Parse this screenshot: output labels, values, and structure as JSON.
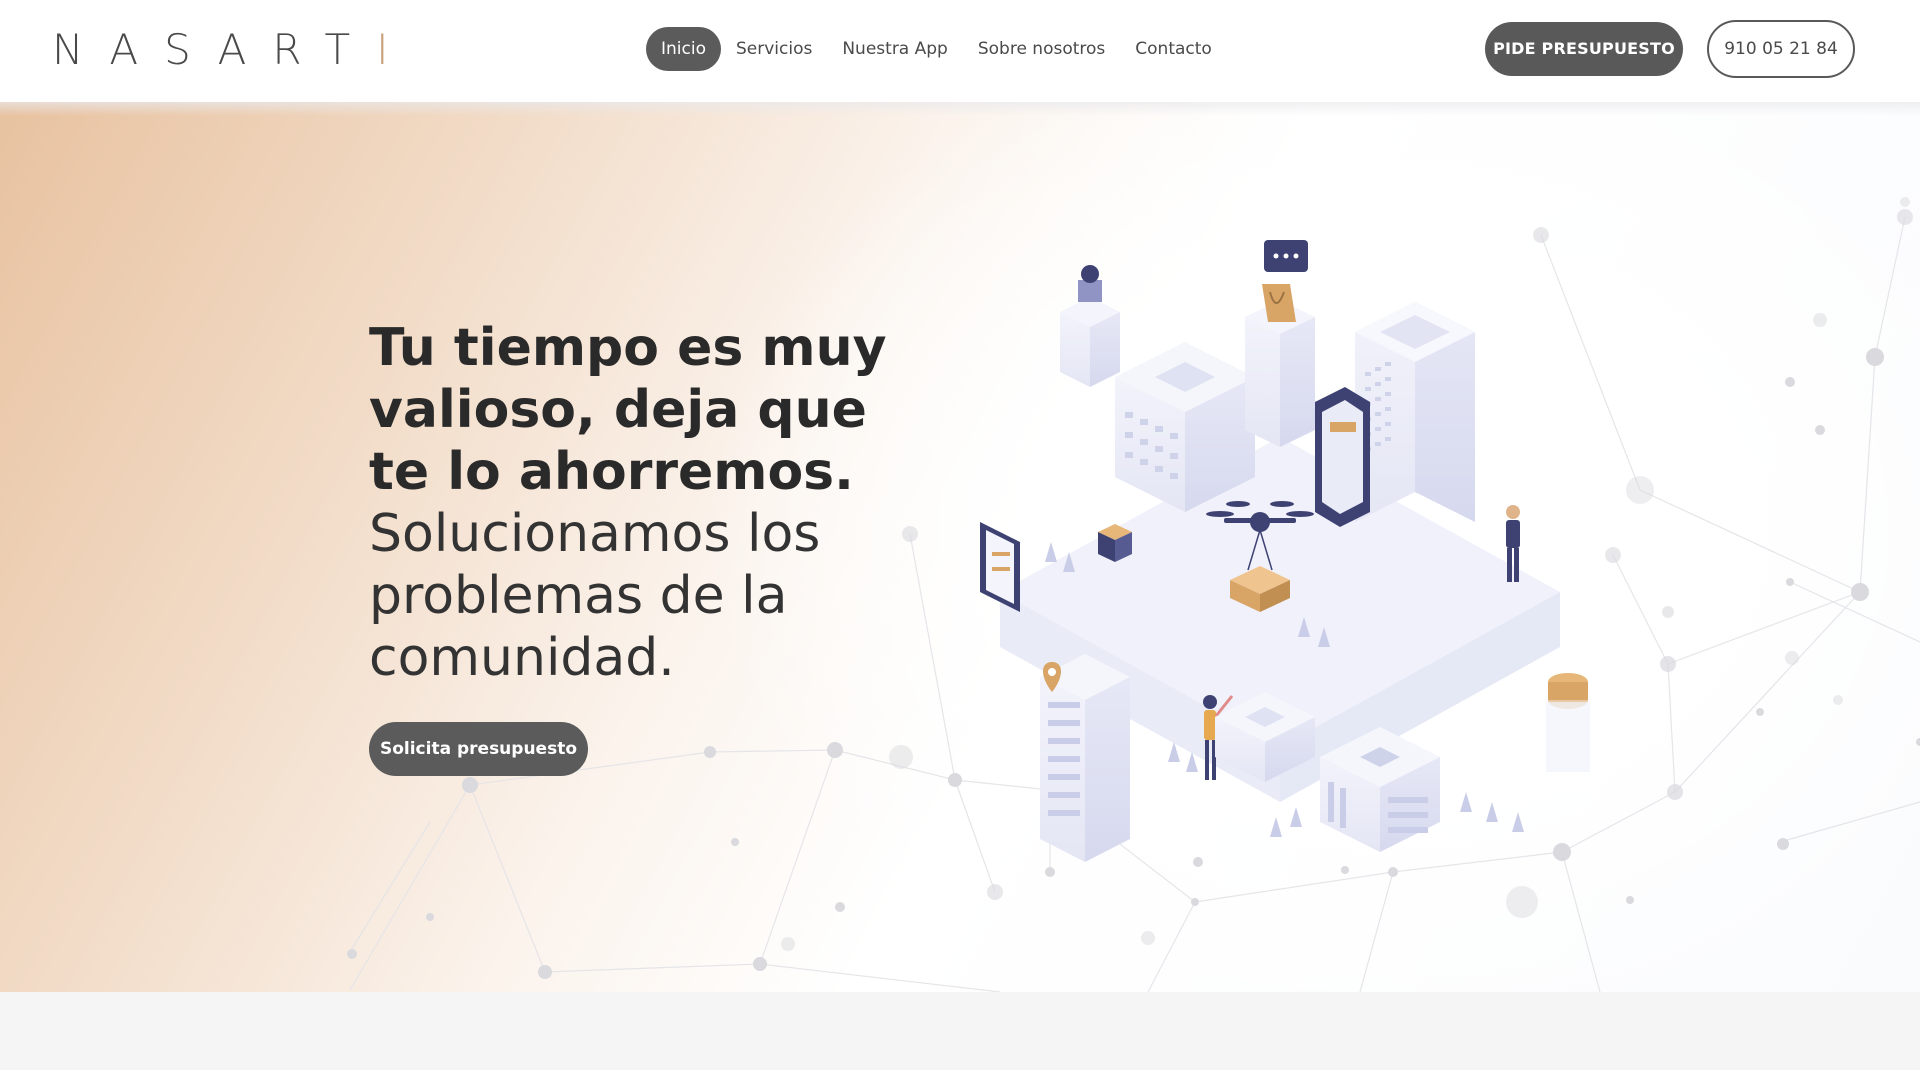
{
  "brand": {
    "logo_main": "NASART",
    "logo_accent": "I",
    "accent_color": "#c8a07a",
    "primary_color": "#595959"
  },
  "nav": {
    "items": [
      {
        "label": "Inicio",
        "active": true
      },
      {
        "label": "Servicios",
        "active": false
      },
      {
        "label": "Nuestra App",
        "active": false
      },
      {
        "label": "Sobre nosotros",
        "active": false
      },
      {
        "label": "Contacto",
        "active": false
      }
    ]
  },
  "header": {
    "quote_button": "PIDE PRESUPUESTO",
    "phone_button": "910 05 21 84"
  },
  "hero": {
    "headline_strong": "Tu tiempo es muy valioso, deja que te lo ahorremos.",
    "headline_light": "Solucionamos los problemas de la comunidad.",
    "cta": "Solicita presupuesto",
    "illustration": "isometric-city-drone-delivery-illustration"
  }
}
